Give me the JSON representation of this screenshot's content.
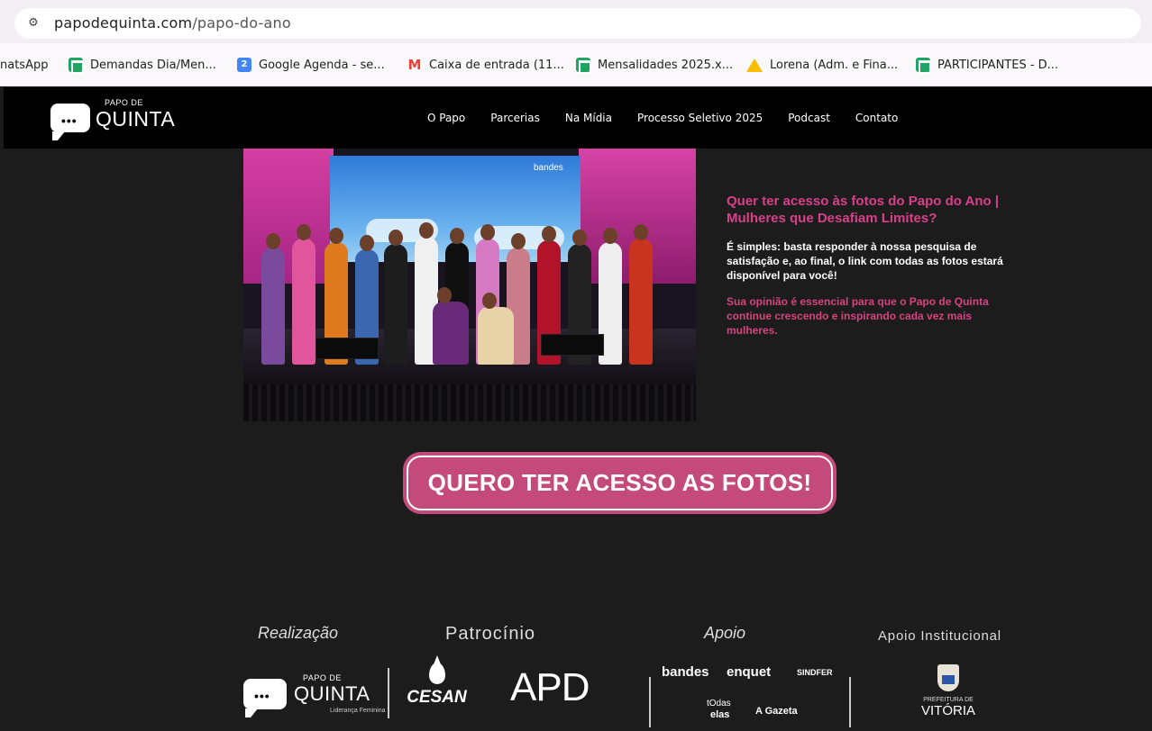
{
  "browser": {
    "url_domain": "papodequinta.com",
    "url_path": "/papo-do-ano",
    "bookmarks": [
      {
        "label": "natsApp",
        "icon": "whatsapp-icon"
      },
      {
        "label": "Demandas Dia/Men...",
        "icon": "google-sheets-icon"
      },
      {
        "label": "Google Agenda - se...",
        "icon": "google-calendar-icon"
      },
      {
        "label": "Caixa de entrada (11...",
        "icon": "gmail-icon"
      },
      {
        "label": "Mensalidades 2025.x...",
        "icon": "google-sheets-icon"
      },
      {
        "label": "Lorena (Adm. e Fina...",
        "icon": "google-drive-icon"
      },
      {
        "label": "PARTICIPANTES - D...",
        "icon": "google-sheets-icon"
      }
    ],
    "calendar_icon_text": "2",
    "gmail_icon_text": "M"
  },
  "header": {
    "logo_small": "PAPO DE",
    "logo_big": "QUINTA",
    "nav": [
      "O Papo",
      "Parcerias",
      "Na Mídia",
      "Processo Seletivo 2025",
      "Podcast",
      "Contato"
    ]
  },
  "photo": {
    "screen_brand": "bandes"
  },
  "info": {
    "question": "Quer ter acesso às fotos do Papo do Ano | Mulheres que Desafiam Limites?",
    "instructions": "É simples: basta responder à nossa pesquisa de satisfação e, ao final, o link com todas as fotos estará disponível para você!",
    "motivation": "Sua opinião é essencial para que o Papo de Quinta continue crescendo e inspirando cada vez mais mulheres."
  },
  "cta": {
    "label": "QUERO TER ACESSO AS FOTOS!"
  },
  "footer": {
    "realizacao": "Realização",
    "patrocinio": "Patrocínio",
    "apoio": "Apoio",
    "apoio_institucional": "Apoio Institucional",
    "quinta_logo_small": "PAPO DE",
    "quinta_logo_big": "QUINTA",
    "quinta_logo_sub": "Liderança Feminina",
    "cesan": "CESAN",
    "apd": "APD",
    "apoio_logos": {
      "bandes": "bandes",
      "enquet": "enquet",
      "sindfer": "SINDFER",
      "todas_elas_1": "tOdas",
      "todas_elas_2": "elas",
      "agazeta": "A Gazeta"
    },
    "prefeitura": "PREFEITURA DE",
    "vitoria": "VITÓRIA"
  },
  "colors": {
    "accent_pink": "#d93f8a",
    "cta_bg": "#c44a7b",
    "page_bg": "#1c1c1c",
    "header_bg": "#000000"
  }
}
